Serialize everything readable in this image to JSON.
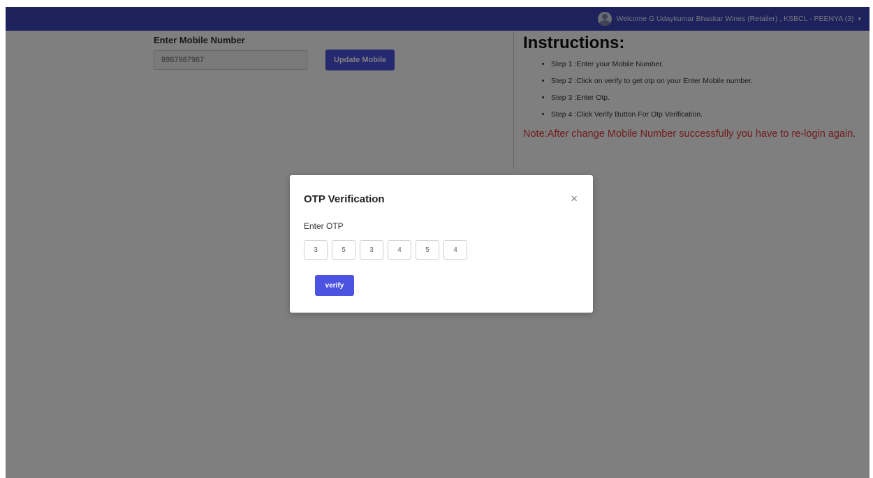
{
  "header": {
    "user_text": "Welcome G Udaykumar Bhaskar Wines (Retailer) , KSBCL - PEENYA (3)",
    "avatar_icon": "user-avatar-icon",
    "dropdown_icon": "caret-down-icon",
    "caret": "▾"
  },
  "form": {
    "mobile_label": "Enter Mobile Number",
    "mobile_value": "8987987987",
    "update_button": "Update Mobile"
  },
  "instructions": {
    "title": "Instructions:",
    "steps": [
      "Step 1 :Enter your Mobile Number.",
      "Step 2 :Click on verify to get otp on your Enter Mobile number.",
      "Step 3 :Enter Otp.",
      "Step 4 :Click Verify Button For Otp Verification."
    ],
    "note": "Note:After change Mobile Number successfully you have to re-login again."
  },
  "modal": {
    "title": "OTP Verification",
    "close_symbol": "×",
    "otp_label": "Enter OTP",
    "otp_digits": [
      "3",
      "5",
      "3",
      "4",
      "5",
      "4"
    ],
    "verify_button": "verify"
  },
  "colors": {
    "header_bg": "#3d44b8",
    "primary_button": "#4b53e0",
    "note_text": "#e23a3a",
    "overlay": "rgba(0,0,0,0.5)"
  }
}
